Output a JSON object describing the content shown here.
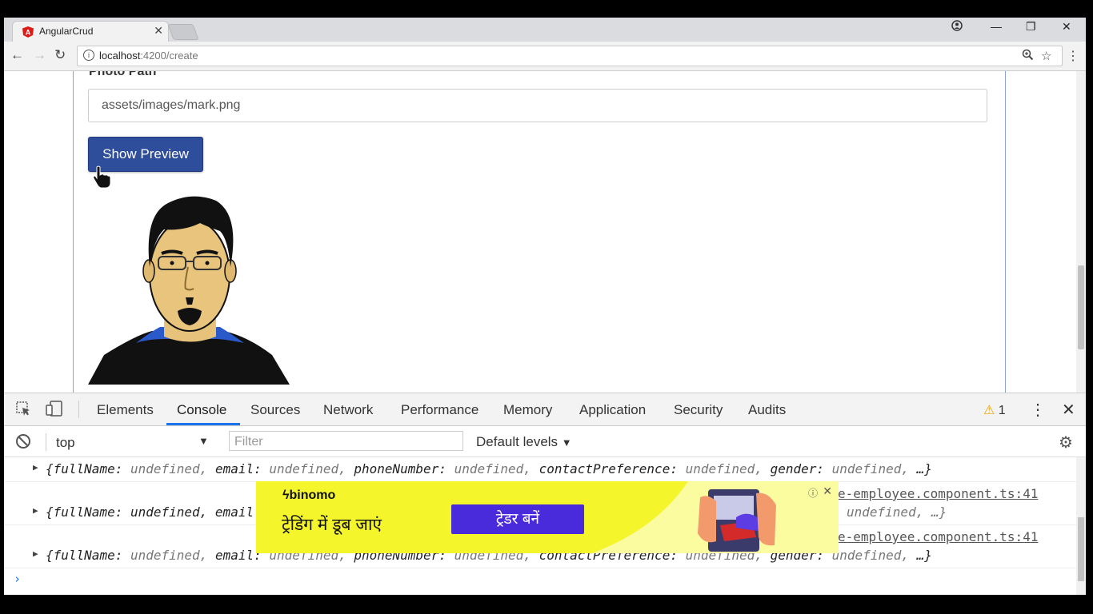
{
  "browser": {
    "tab_title": "AngularCrud",
    "url_host": "localhost",
    "url_rest": ":4200/create",
    "info_glyph": "i"
  },
  "page": {
    "photo_label": "Photo Path",
    "photo_value": "assets/images/mark.png",
    "preview_button": "Show Preview"
  },
  "devtools": {
    "tabs": [
      "Elements",
      "Console",
      "Sources",
      "Network",
      "Performance",
      "Memory",
      "Application",
      "Security",
      "Audits"
    ],
    "active_tab": "Console",
    "warning_count": "1",
    "context": "top",
    "filter_placeholder": "Filter",
    "levels": "Default levels"
  },
  "console": {
    "rows": [
      {
        "pairs": [
          "fullName:",
          "undefined,",
          "email:",
          "undefined,",
          "phoneNumber:",
          "undefined,",
          "contactPreference:",
          "undefined,",
          "gender:",
          "undefined,",
          "…}"
        ]
      },
      {
        "source": "e-employee.component.ts:41",
        "visible_prefix": "{fullName: undefined, email",
        "visible_suffix": "undefined, …}"
      },
      {
        "source": "e-employee.component.ts:41",
        "pairs": [
          "fullName:",
          "undefined,",
          "email:",
          "undefined,",
          "phoneNumber:",
          "undefined,",
          "contactPreference:",
          "undefined,",
          "gender:",
          "undefined,",
          "…}"
        ]
      }
    ]
  },
  "ad": {
    "brand": "binomo",
    "headline": "ट्रेडिंग में डूब जाएं",
    "cta": "ट्रेडर बनें"
  },
  "colors": {
    "button_blue": "#2e4d9b",
    "devtools_accent": "#1a73e8",
    "ad_yellow": "#f4f52a",
    "ad_cta": "#4a2bdc"
  }
}
